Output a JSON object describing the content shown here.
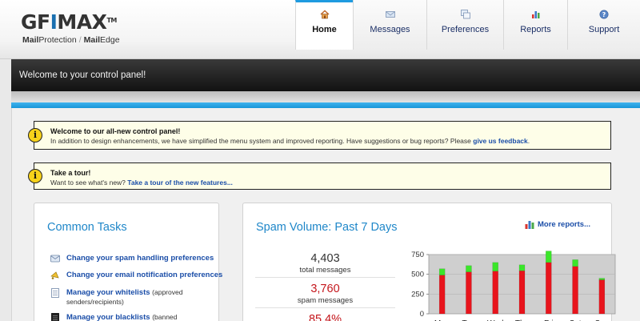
{
  "logo": {
    "part_gfi": "GF",
    "part_i": "I",
    "part_max": "MAX",
    "tm": "TM",
    "mail": "Mail",
    "protection": "Protection",
    "slash": "/",
    "mail2": "Mail",
    "edge": "Edge"
  },
  "nav": [
    {
      "label": "Home",
      "icon": "home-icon"
    },
    {
      "label": "Messages",
      "icon": "envelope-icon"
    },
    {
      "label": "Preferences",
      "icon": "windows-icon"
    },
    {
      "label": "Reports",
      "icon": "bar-chart-icon"
    },
    {
      "label": "Support",
      "icon": "help-icon"
    }
  ],
  "banner": {
    "text": "Welcome to your control panel!"
  },
  "notices": {
    "welcome": {
      "title": "Welcome to our all-new control panel!",
      "body": "In addition to design enhancements, we have simplified the menu system and improved reporting. Have suggestions or bug reports? Please ",
      "link": "give us feedback",
      "tail": "."
    },
    "tour": {
      "title": "Take a tour!",
      "body": "Want to see what's new? ",
      "link": "Take a tour of the new features..."
    }
  },
  "common_tasks": {
    "title": "Common Tasks",
    "items": [
      {
        "label": "Change your spam handling preferences",
        "icon": "spam-preferences-icon"
      },
      {
        "label": "Change your email notification preferences",
        "icon": "notification-icon"
      },
      {
        "label": "Manage your whitelists",
        "note": "(approved",
        "note2": "senders/recipients)",
        "icon": "whitelist-icon"
      },
      {
        "label": "Manage your blacklists",
        "note": "(banned",
        "icon": "blacklist-icon"
      }
    ]
  },
  "spam_volume": {
    "title": "Spam Volume: Past 7 Days",
    "more_reports": "More reports...",
    "stats": [
      {
        "value": "4,403",
        "label": "total messages",
        "color": "#333333"
      },
      {
        "value": "3,760",
        "label": "spam messages",
        "color": "#c4161c"
      },
      {
        "value": "85.4%",
        "label": "",
        "color": "#c4161c"
      }
    ]
  },
  "colors": {
    "accent": "#1f87c9",
    "spam": "#e8141c",
    "clean": "#3be62a",
    "strip": "#1796d8"
  },
  "chart_data": {
    "type": "bar",
    "stacked": true,
    "categories": [
      "Mon",
      "Tue",
      "Wed",
      "Thu",
      "Fri",
      "Sat",
      "Sun"
    ],
    "series": [
      {
        "values": [
          490,
          530,
          540,
          545,
          650,
          600,
          430
        ]
      },
      {
        "values": [
          80,
          80,
          110,
          75,
          145,
          85,
          20
        ]
      }
    ],
    "ylim": [
      0,
      750
    ],
    "yticks": [
      0,
      250,
      500,
      750
    ],
    "grid": true
  }
}
